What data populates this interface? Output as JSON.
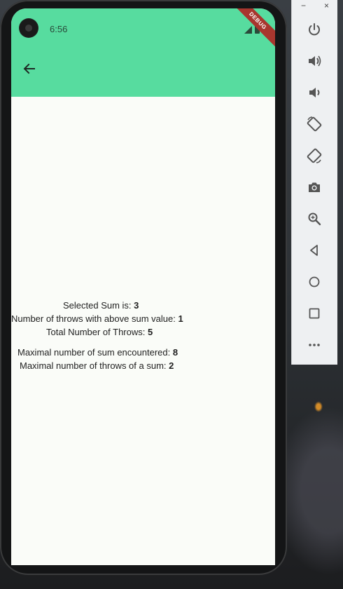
{
  "status_bar": {
    "time": "6:56",
    "debug_label": "DEBUG"
  },
  "app_bar": {
    "color": "#57dc9f",
    "back_icon": "arrow-left-icon"
  },
  "content": {
    "selected_sum_label": "Selected Sum is: ",
    "selected_sum_value": "3",
    "throws_with_sum_label": "Number of throws with above sum value: ",
    "throws_with_sum_value": "1",
    "total_throws_label": "Total Number of Throws: ",
    "total_throws_value": "5",
    "max_sum_label": "Maximal number of sum encountered: ",
    "max_sum_value": "8",
    "max_throws_label": "Maximal number of throws of a sum: ",
    "max_throws_value": "2"
  },
  "emulator_toolbar": {
    "minimize": "−",
    "close": "×",
    "buttons": [
      "power-icon",
      "volume-up-icon",
      "volume-down-icon",
      "rotate-left-icon",
      "rotate-right-icon",
      "camera-icon",
      "zoom-icon",
      "back-icon",
      "home-icon",
      "overview-icon",
      "more-icon"
    ]
  }
}
